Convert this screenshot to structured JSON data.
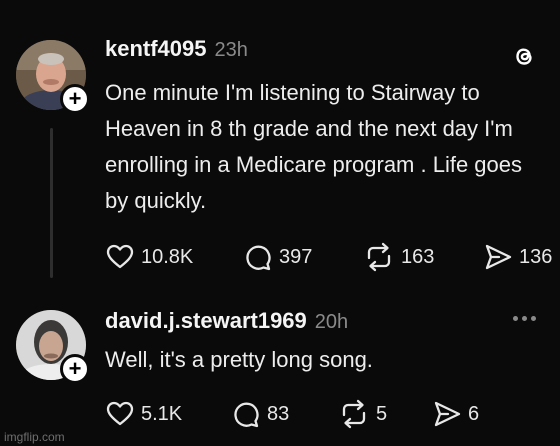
{
  "posts": [
    {
      "username": "kentf4095",
      "time": "23h",
      "text": "One minute I'm listening to Stairway to Heaven in 8 th grade and the next day I'm enrolling in a Medicare program . Life goes by quickly.",
      "actions": {
        "likes": "10.8K",
        "replies": "397",
        "reposts": "163",
        "shares": "136"
      },
      "icons": [
        "threads-logo-icon",
        "heart-icon",
        "comment-icon",
        "repost-icon",
        "share-icon",
        "plus-icon"
      ]
    },
    {
      "username": "david.j.stewart1969",
      "time": "20h",
      "text": "Well, it's a pretty long song.",
      "actions": {
        "likes": "5.1K",
        "replies": "83",
        "reposts": "5",
        "shares": "6"
      },
      "icons": [
        "more-icon",
        "heart-icon",
        "comment-icon",
        "repost-icon",
        "share-icon",
        "plus-icon"
      ]
    }
  ],
  "plus_symbol": "+",
  "watermark": "imgflip.com",
  "colors": {
    "background": "#0a0a0a",
    "text": "#ededed",
    "muted": "#8a8a8a",
    "thread_line": "#2e2e2e"
  }
}
